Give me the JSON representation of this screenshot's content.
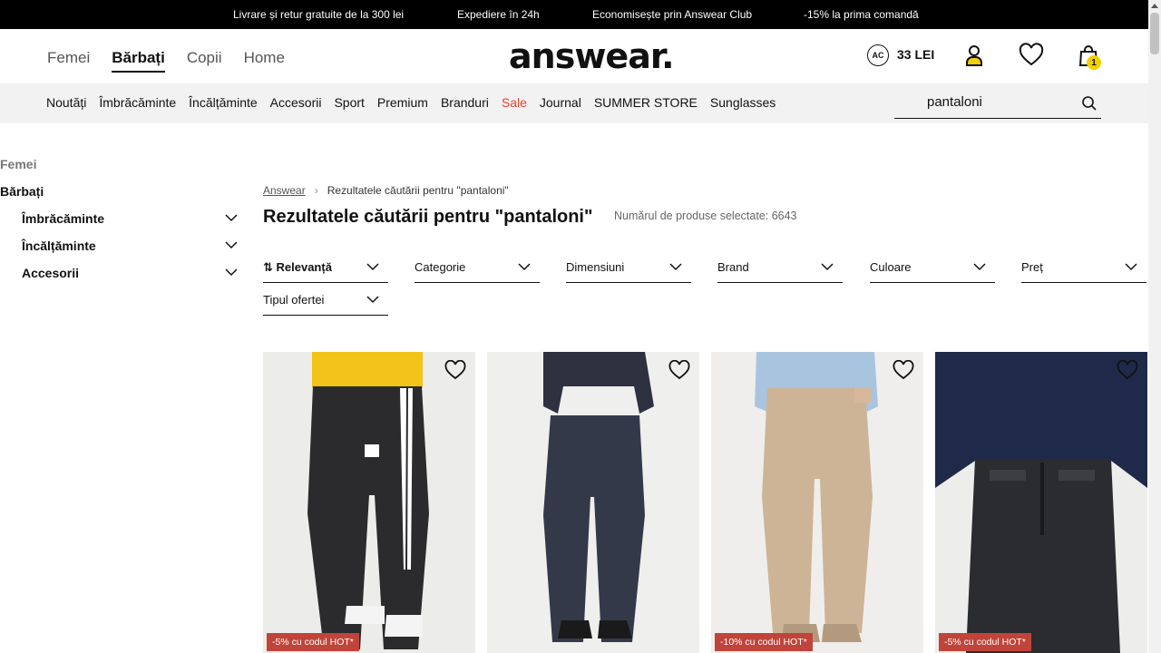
{
  "promo_bar": [
    "Livrare și retur gratuite de la 300 lei",
    "Expediere în 24h",
    "Economisește prin Answear Club",
    "-15% la prima comandă"
  ],
  "gender_nav": [
    {
      "label": "Femei",
      "active": false
    },
    {
      "label": "Bărbați",
      "active": true
    },
    {
      "label": "Copii",
      "active": false
    },
    {
      "label": "Home",
      "active": false
    }
  ],
  "logo": "answear.",
  "club": {
    "badge": "AC",
    "amount": "33 LEI"
  },
  "cart_count": "1",
  "categories": [
    "Noutăți",
    "Îmbrăcăminte",
    "Încălțăminte",
    "Accesorii",
    "Sport",
    "Premium",
    "Branduri",
    "Sale",
    "Journal",
    "SUMMER STORE",
    "Sunglasses"
  ],
  "search": {
    "value": "pantaloni"
  },
  "sidebar": {
    "top": [
      "Femei",
      "Bărbați"
    ],
    "sub": [
      "Îmbrăcăminte",
      "Încălțăminte",
      "Accesorii"
    ]
  },
  "breadcrumb": {
    "home": "Answear",
    "current": "Rezultatele căutării pentru \"pantaloni\""
  },
  "title": "Rezultatele căutării pentru \"pantaloni\"",
  "product_count_label": "Numărul de produse selectate: 6643",
  "filters": [
    "Relevanță",
    "Categorie",
    "Dimensiuni",
    "Brand",
    "Culoare",
    "Preț",
    "Tipul ofertei"
  ],
  "products": [
    {
      "badge": "-5% cu codul HOT*"
    },
    {
      "badge": ""
    },
    {
      "badge": "-10% cu codul HOT*"
    },
    {
      "badge": "-5% cu codul HOT*"
    }
  ],
  "colors": {
    "sale": "#e8402f",
    "badge": "#c0443a",
    "cart_badge": "#f5d000"
  }
}
